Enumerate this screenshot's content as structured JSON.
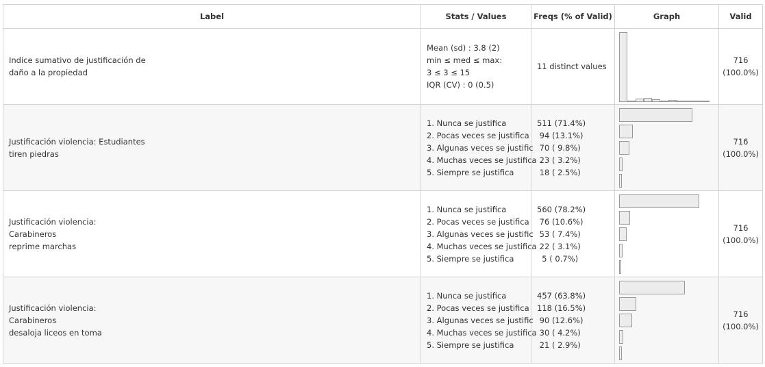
{
  "header": {
    "label": "Label",
    "stats": "Stats / Values",
    "freqs": "Freqs (% of Valid)",
    "graph": "Graph",
    "valid": "Valid"
  },
  "rows": [
    {
      "label_lines": [
        "Indice sumativo de justificación de",
        "daño a la propiedad"
      ],
      "stats_lines": [
        "Mean (sd) : 3.8 (2)",
        "min ≤ med ≤ max:",
        "3 ≤ 3 ≤ 15",
        "IQR (CV) : 0 (0.5)"
      ],
      "freqs_lines": [
        "11 distinct values"
      ],
      "histogram": [
        1.0,
        0.0,
        0.05,
        0.06,
        0.04,
        0.02,
        0.03,
        0.0,
        0.01,
        0.01,
        0.01
      ],
      "valid_count": "716",
      "valid_pct": "(100.0%)"
    },
    {
      "label_lines": [
        "Justificación violencia: Estudiantes",
        "tiren piedras"
      ],
      "stats_lines": [
        "1. Nunca se justifica",
        "2. Pocas veces se justifica",
        "3. Algunas veces se justific",
        "4. Muchas veces se justifica",
        "5. Siempre se justifica"
      ],
      "freqs_lines": [
        "511 (71.4%)",
        " 94 (13.1%)",
        " 70 ( 9.8%)",
        " 23 ( 3.2%)",
        " 18 ( 2.5%)"
      ],
      "bar_fracs": [
        0.714,
        0.131,
        0.098,
        0.032,
        0.025
      ],
      "valid_count": "716",
      "valid_pct": "(100.0%)"
    },
    {
      "label_lines": [
        "Justificación violencia: Carabineros",
        "reprime marchas"
      ],
      "stats_lines": [
        "1. Nunca se justifica",
        "2. Pocas veces se justifica",
        "3. Algunas veces se justific",
        "4. Muchas veces se justifica",
        "5. Siempre se justifica"
      ],
      "freqs_lines": [
        "560 (78.2%)",
        " 76 (10.6%)",
        " 53 ( 7.4%)",
        " 22 ( 3.1%)",
        "  5 ( 0.7%)"
      ],
      "bar_fracs": [
        0.782,
        0.106,
        0.074,
        0.031,
        0.007
      ],
      "valid_count": "716",
      "valid_pct": "(100.0%)"
    },
    {
      "label_lines": [
        "Justificación violencia: Carabineros",
        "desaloja liceos en toma"
      ],
      "stats_lines": [
        "1. Nunca se justifica",
        "2. Pocas veces se justifica",
        "3. Algunas veces se justific",
        "4. Muchas veces se justifica",
        "5. Siempre se justifica"
      ],
      "freqs_lines": [
        "457 (63.8%)",
        "118 (16.5%)",
        " 90 (12.6%)",
        " 30 ( 4.2%)",
        " 21 ( 2.9%)"
      ],
      "bar_fracs": [
        0.638,
        0.165,
        0.126,
        0.042,
        0.029
      ],
      "valid_count": "716",
      "valid_pct": "(100.0%)"
    }
  ]
}
